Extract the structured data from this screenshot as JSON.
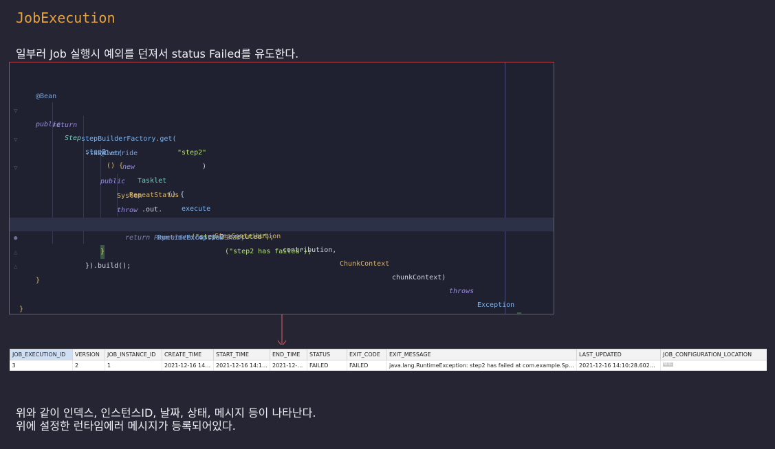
{
  "heading": "JobExecution",
  "intro": "일부러 Job 실행시 예외를 던져서 status Failed를 유도한다.",
  "code": {
    "annotation_bean": "@Bean",
    "kw_public": "public",
    "type_step": "Step",
    "method_step2": "step2",
    "parens": "() {",
    "kw_return": "return",
    "factory_call": "stepBuilderFactory.get(",
    "str_step2": "\"step2\"",
    "close_paren": ")",
    "tasklet_call": ".tasklet(",
    "kw_new": "new",
    "cls_tasklet": "Tasklet",
    "paren_brace": "() {",
    "annotation_override": "@Override",
    "cls_repeat_status": "RepeatStatus",
    "method_execute": "execute",
    "params_open": "(",
    "cls_step_contribution": "StepContribution",
    "param_contribution": "contribution,",
    "cls_chunk_context": "ChunkContext",
    "param_chunk_context": "chunkContext)",
    "kw_throws": "throws",
    "cls_exception": "Exception",
    "open_brace": "{",
    "cls_system": "System",
    "member_out": ".out.",
    "method_println": "println",
    "str_step2_executed": "(\"step 2 executed\");",
    "kw_throw": "throw",
    "cls_runtime_exception": "RuntimeException",
    "str_step2_failed": "(\"step2 has failed\");",
    "comment_marker": "//",
    "commented_return": "return RepeatStatus.FINISHED;",
    "close_brace": "}",
    "build_call": "}).build();",
    "close_brace_2": "}",
    "close_brace_3": "}"
  },
  "table": {
    "headers": [
      "JOB_EXECUTION_ID",
      "VERSION",
      "JOB_INSTANCE_ID",
      "CREATE_TIME",
      "START_TIME",
      "END_TIME",
      "STATUS",
      "EXIT_CODE",
      "EXIT_MESSAGE",
      "LAST_UPDATED",
      "JOB_CONFIGURATION_LOCATION"
    ],
    "row": [
      "3",
      "2",
      "1",
      "2021-12-16 14:...",
      "2021-12-16 14:10...",
      "2021-12-1...",
      "FAILED",
      "FAILED",
      "java.lang.RuntimeException: step2 has failed at com.example.SpringB...",
      "2021-12-16 14:10:28.602000",
      "NULL"
    ]
  },
  "outro_line1": "위와 같이 인덱스, 인스턴스ID, 날짜, 상태, 메시지 등이 나타난다.",
  "outro_line2": "위에 설정한 런타임에러 메시지가 등록되어있다.",
  "colors": {
    "background": "#252533",
    "heading": "#e8a33d",
    "code_border": "#b8434b",
    "arrow": "#c9545c"
  }
}
